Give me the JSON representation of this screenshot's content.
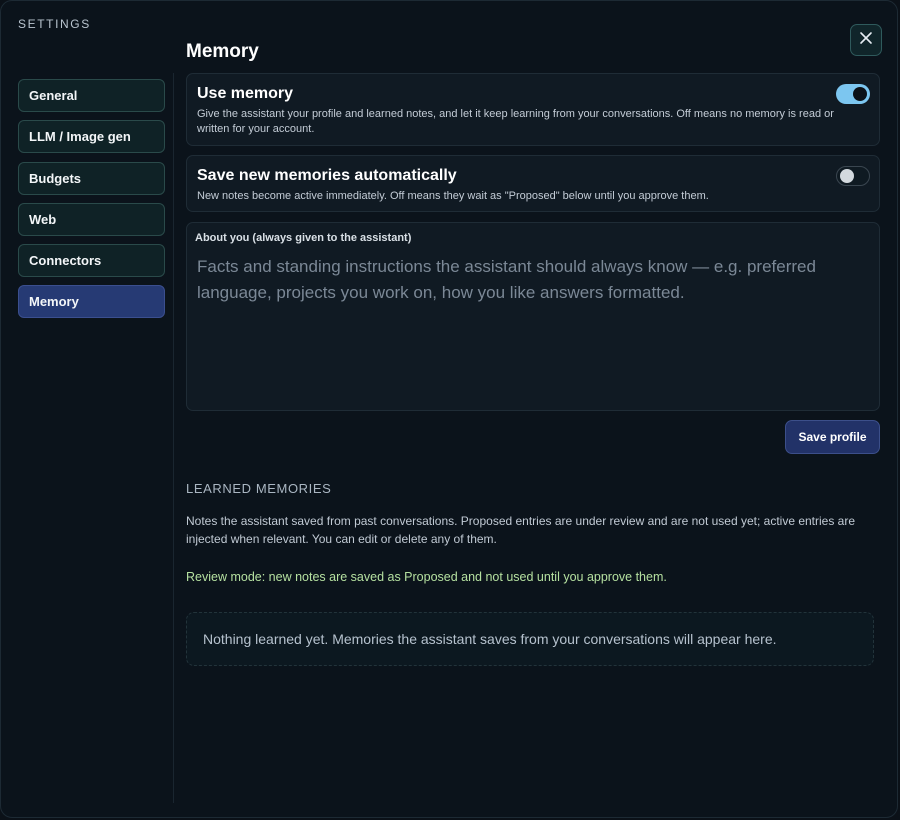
{
  "app": {
    "settings_title": "SETTINGS",
    "close_icon": "close-icon"
  },
  "sidebar": {
    "items": [
      {
        "label": "General",
        "active": false
      },
      {
        "label": "LLM / Image gen",
        "active": false
      },
      {
        "label": "Budgets",
        "active": false
      },
      {
        "label": "Web",
        "active": false
      },
      {
        "label": "Connectors",
        "active": false
      },
      {
        "label": "Memory",
        "active": true
      }
    ]
  },
  "main": {
    "title": "Memory",
    "use_memory": {
      "title": "Use memory",
      "description": "Give the assistant your profile and learned notes, and let it keep learning from your conversations. Off means no memory is read or written for your account.",
      "enabled": true
    },
    "auto_save": {
      "title": "Save new memories automatically",
      "description": "New notes become active immediately. Off means they wait as \"Proposed\" below until you approve them.",
      "enabled": false
    },
    "about": {
      "label": "About you (always given to the assistant)",
      "placeholder": "Facts and standing instructions the assistant should always know — e.g. preferred language, projects you work on, how you like answers formatted."
    },
    "save_profile_label": "Save profile",
    "learned": {
      "heading": "LEARNED MEMORIES",
      "description": "Notes the assistant saved from past conversations. Proposed entries are under review and are not used yet; active entries are injected when relevant. You can edit or delete any of them.",
      "review_note": "Review mode: new notes are saved as Proposed and not used until you approve them.",
      "empty_state": "Nothing learned yet. Memories the assistant saves from your conversations will appear here."
    }
  },
  "colors": {
    "accent": "#263a74",
    "toggle_on": "#7cc6f0",
    "review_text": "#b5e0a0"
  }
}
